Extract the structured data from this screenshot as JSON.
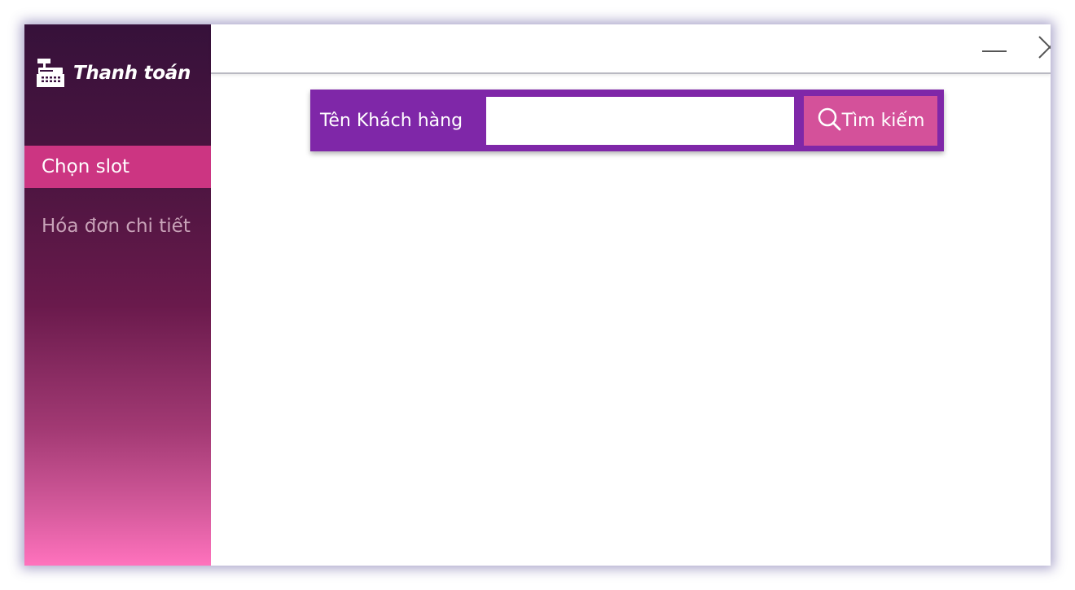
{
  "sidebar": {
    "brand": {
      "icon": "cash-register-icon",
      "title": "Thanh toán"
    },
    "items": [
      {
        "label": "Chọn slot",
        "active": true
      },
      {
        "label": "Hóa đơn chi tiết",
        "active": false
      }
    ]
  },
  "titlebar": {
    "minimize_icon": "minimize-icon",
    "close_icon": "close-icon"
  },
  "search": {
    "label": "Tên Khách hàng",
    "value": "",
    "placeholder": "",
    "button_label": "Tìm kiếm",
    "button_icon": "search-icon"
  },
  "colors": {
    "sidebar_top": "#36113a",
    "sidebar_bottom": "#ff72bd",
    "active_item": "#cc3582",
    "search_panel": "#7f27a8",
    "search_button": "#d4519a"
  }
}
